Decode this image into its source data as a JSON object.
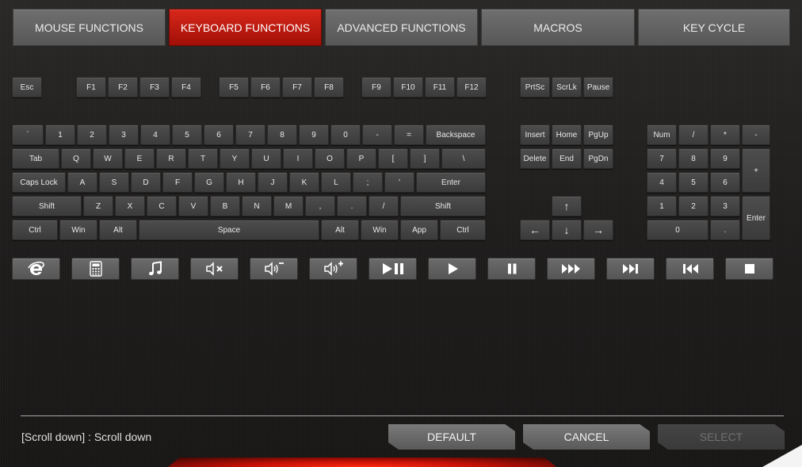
{
  "tabs": [
    {
      "label": "MOUSE FUNCTIONS",
      "active": false
    },
    {
      "label": "KEYBOARD FUNCTIONS",
      "active": true
    },
    {
      "label": "ADVANCED FUNCTIONS",
      "active": false
    },
    {
      "label": "MACROS",
      "active": false
    },
    {
      "label": "KEY CYCLE",
      "active": false
    }
  ],
  "keys": {
    "function_row": [
      "Esc",
      "F1",
      "F2",
      "F3",
      "F4",
      "F5",
      "F6",
      "F7",
      "F8",
      "F9",
      "F10",
      "F11",
      "F12",
      "PrtSc",
      "ScrLk",
      "Pause"
    ],
    "number_row": [
      "`",
      "1",
      "2",
      "3",
      "4",
      "5",
      "6",
      "7",
      "8",
      "9",
      "0",
      "-",
      "=",
      "Backspace"
    ],
    "qwerty_row": [
      "Tab",
      "Q",
      "W",
      "E",
      "R",
      "T",
      "Y",
      "U",
      "I",
      "O",
      "P",
      "[",
      "]",
      "\\"
    ],
    "home_row": [
      "Caps Lock",
      "A",
      "S",
      "D",
      "F",
      "G",
      "H",
      "J",
      "K",
      "L",
      ";",
      "'",
      "Enter"
    ],
    "shift_row": [
      "Shift",
      "Z",
      "X",
      "C",
      "V",
      "B",
      "N",
      "M",
      ",",
      ".",
      "/",
      "Shift"
    ],
    "bottom_row": [
      "Ctrl",
      "Win",
      "Alt",
      "Space",
      "Alt",
      "Win",
      "App",
      "Ctrl"
    ],
    "nav_top": [
      "Insert",
      "Home",
      "PgUp"
    ],
    "nav_bottom": [
      "Delete",
      "End",
      "PgDn"
    ],
    "arrows": [
      "↑",
      "←",
      "↓",
      "→"
    ],
    "numpad": [
      "Num",
      "/",
      "*",
      "-",
      "7",
      "8",
      "9",
      "+",
      "4",
      "5",
      "6",
      "1",
      "2",
      "3",
      "Enter",
      "0",
      "."
    ]
  },
  "media_keys": [
    "internet-explorer-icon",
    "calculator-icon",
    "music-icon",
    "mute-icon",
    "volume-down-icon",
    "volume-up-icon",
    "play-pause-icon",
    "play-icon",
    "pause-icon",
    "fast-forward-icon",
    "next-track-icon",
    "previous-track-icon",
    "stop-icon"
  ],
  "status_text": "[Scroll down] : Scroll down",
  "buttons": {
    "default": "DEFAULT",
    "cancel": "CANCEL",
    "select": "SELECT"
  },
  "colors": {
    "accent": "#c4190c",
    "key": "#444444",
    "tab": "#626262"
  }
}
